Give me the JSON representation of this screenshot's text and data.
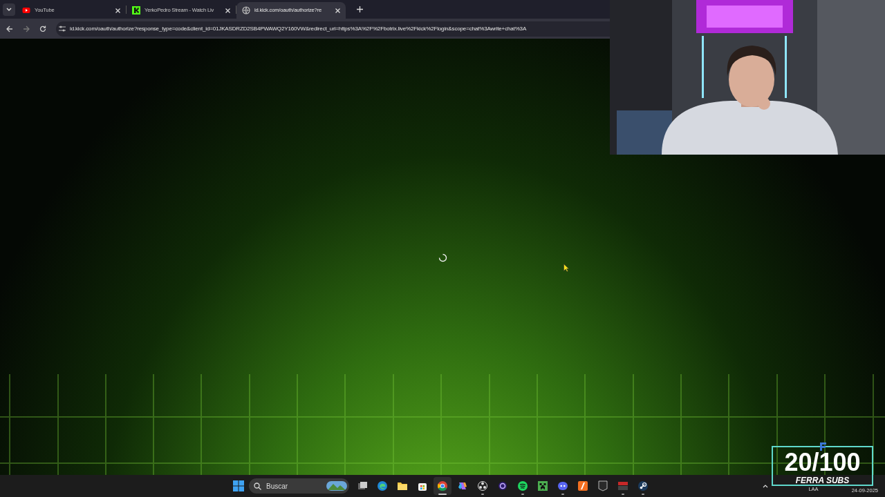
{
  "browser": {
    "tabs": [
      {
        "title": "YouTube",
        "kind": "youtube",
        "selected": false
      },
      {
        "title": "YerkoPedro Stream - Watch Liv",
        "kind": "kick",
        "selected": false
      },
      {
        "title": "id.kick.com/oauth/authorize?re",
        "kind": "globe",
        "selected": true
      }
    ],
    "address": "id.kick.com/oauth/authorize?response_type=code&client_id=01JKASDRZD2SB4PWAWQ2Y160VW&redirect_uri=https%3A%2F%2Fbotrix.live%2Fkick%2Flogin&scope=chat%3Awrite+chat%3A",
    "loading": true
  },
  "counter": {
    "count": "20/100",
    "label": "FERRA SUBS"
  },
  "taskbar": {
    "search_placeholder": "Buscar",
    "apps": [
      {
        "kind": "taskview",
        "running": false,
        "selected": false
      },
      {
        "kind": "edge",
        "running": false,
        "selected": false
      },
      {
        "kind": "folder",
        "running": false,
        "selected": false
      },
      {
        "kind": "store",
        "running": false,
        "selected": false
      },
      {
        "kind": "chrome",
        "running": true,
        "selected": true
      },
      {
        "kind": "copilot",
        "running": false,
        "selected": false
      },
      {
        "kind": "obs",
        "running": true,
        "selected": false
      },
      {
        "kind": "ring",
        "running": false,
        "selected": false
      },
      {
        "kind": "spotify",
        "running": true,
        "selected": false
      },
      {
        "kind": "creeper",
        "running": false,
        "selected": false
      },
      {
        "kind": "discord",
        "running": true,
        "selected": false
      },
      {
        "kind": "orange",
        "running": false,
        "selected": false
      },
      {
        "kind": "epic",
        "running": false,
        "selected": false
      },
      {
        "kind": "voicemeeter",
        "running": true,
        "selected": false
      },
      {
        "kind": "steam",
        "running": true,
        "selected": false
      }
    ],
    "language": "LAA",
    "date": "24-09-2025"
  }
}
